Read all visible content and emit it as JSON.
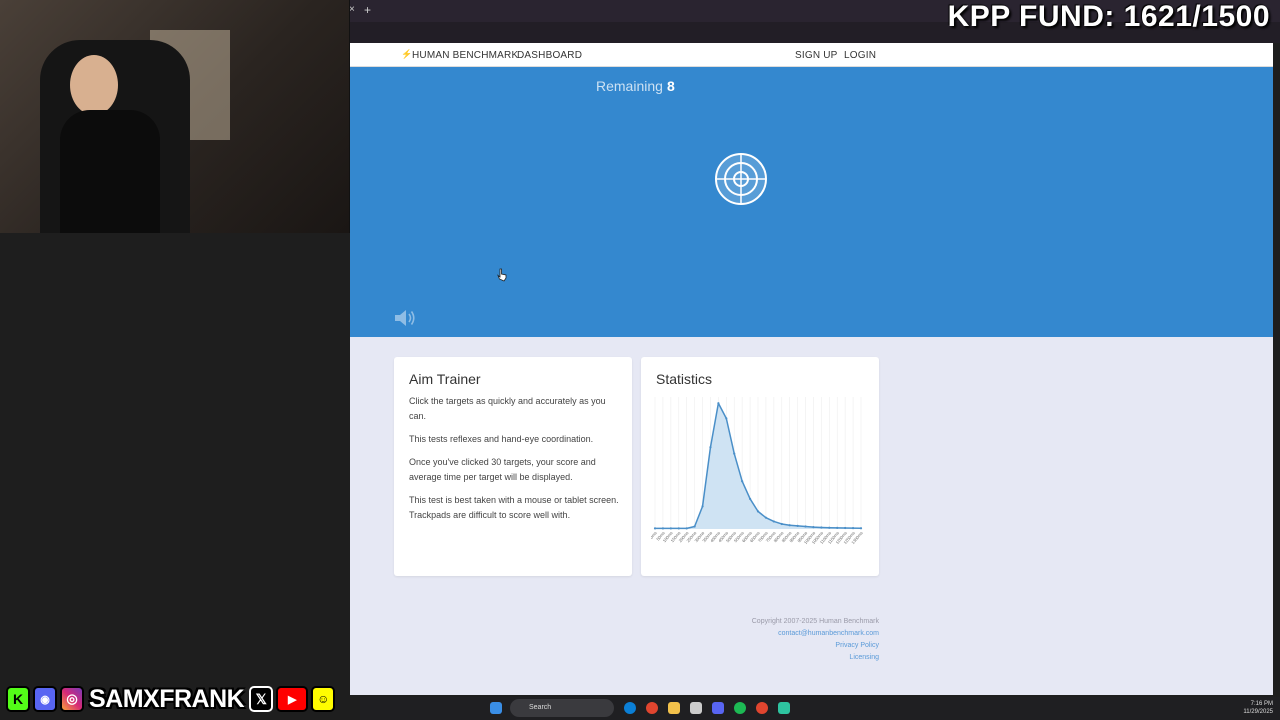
{
  "overlay": {
    "fund_text": "KPP FUND: 1621/1500",
    "handle": "SAMXFRANK",
    "social_icons": [
      "kick-icon",
      "discord-icon",
      "instagram-icon",
      "x-icon",
      "youtube-icon",
      "snapchat-icon"
    ]
  },
  "browser": {
    "new_tab": "+",
    "close_tab": "×"
  },
  "nav": {
    "brand": "HUMAN BENCHMARK",
    "dashboard": "DASHBOARD",
    "signup": "SIGN UP",
    "login": "LOGIN"
  },
  "game": {
    "remaining_label": "Remaining",
    "remaining_value": "8"
  },
  "info_card": {
    "title": "Aim Trainer",
    "paragraphs": [
      "Click the targets as quickly and accurately as you can.",
      "This tests reflexes and hand-eye coordination.",
      "Once you've clicked 30 targets, your score and average time per target will be displayed.",
      "This test is best taken with a mouse or tablet screen. Trackpads are difficult to score well with."
    ]
  },
  "stats_card": {
    "title": "Statistics"
  },
  "chart_data": {
    "type": "area",
    "x": [
      "0ms",
      "50ms",
      "100ms",
      "150ms",
      "200ms",
      "250ms",
      "300ms",
      "350ms",
      "400ms",
      "450ms",
      "500ms",
      "550ms",
      "600ms",
      "650ms",
      "700ms",
      "750ms",
      "800ms",
      "850ms",
      "900ms",
      "950ms",
      "1000ms",
      "1050ms",
      "1100ms",
      "1150ms",
      "1200ms",
      "1250ms",
      "1300ms"
    ],
    "y": [
      0.5,
      0.5,
      0.5,
      0.5,
      0.5,
      2,
      18,
      65,
      100,
      88,
      60,
      38,
      24,
      14,
      9,
      6,
      4,
      3,
      2.5,
      2,
      1.5,
      1.2,
      1,
      0.9,
      0.8,
      0.7,
      0.6
    ],
    "ylim": [
      0,
      105
    ],
    "color": "#4a8fc8",
    "fill": "#cfe3f3",
    "grid": true
  },
  "footer": {
    "copyright": "Copyright 2007-2025 Human Benchmark",
    "email": "contact@humanbenchmark.com",
    "privacy": "Privacy Policy",
    "licensing": "Licensing"
  },
  "taskbar": {
    "search_placeholder": "Search",
    "time": "7:16 PM",
    "date": "11/29/2025"
  }
}
